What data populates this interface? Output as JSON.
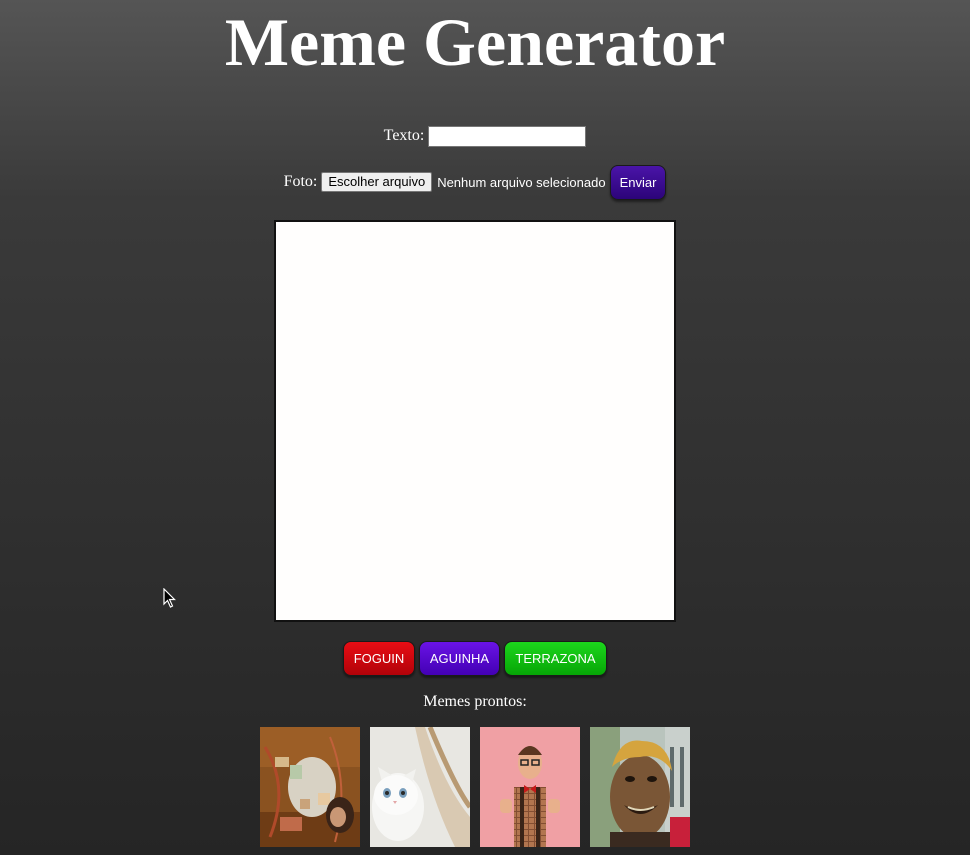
{
  "page": {
    "title": "Meme Generator"
  },
  "form": {
    "text_label": "Texto:",
    "text_value": "",
    "photo_label": "Foto:",
    "file_button_label": "Escolher arquivo",
    "file_status": "Nenhum arquivo selecionado",
    "submit_label": "Enviar"
  },
  "filters": [
    {
      "label": "FOGUIN",
      "color": "#d9050e"
    },
    {
      "label": "AGUINHA",
      "color": "#5a0ad8"
    },
    {
      "label": "TERRAZONA",
      "color": "#11c511"
    }
  ],
  "ready_memes": {
    "label": "Memes prontos:",
    "items": [
      "toddler-lying-photo",
      "white-kitten-photo",
      "man-thumbs-up-photo",
      "laughing-man-photo"
    ]
  },
  "colors": {
    "background_top": "#555555",
    "background_bottom": "#252525",
    "canvas": "#fffefd",
    "submit": "#3b0a95"
  }
}
